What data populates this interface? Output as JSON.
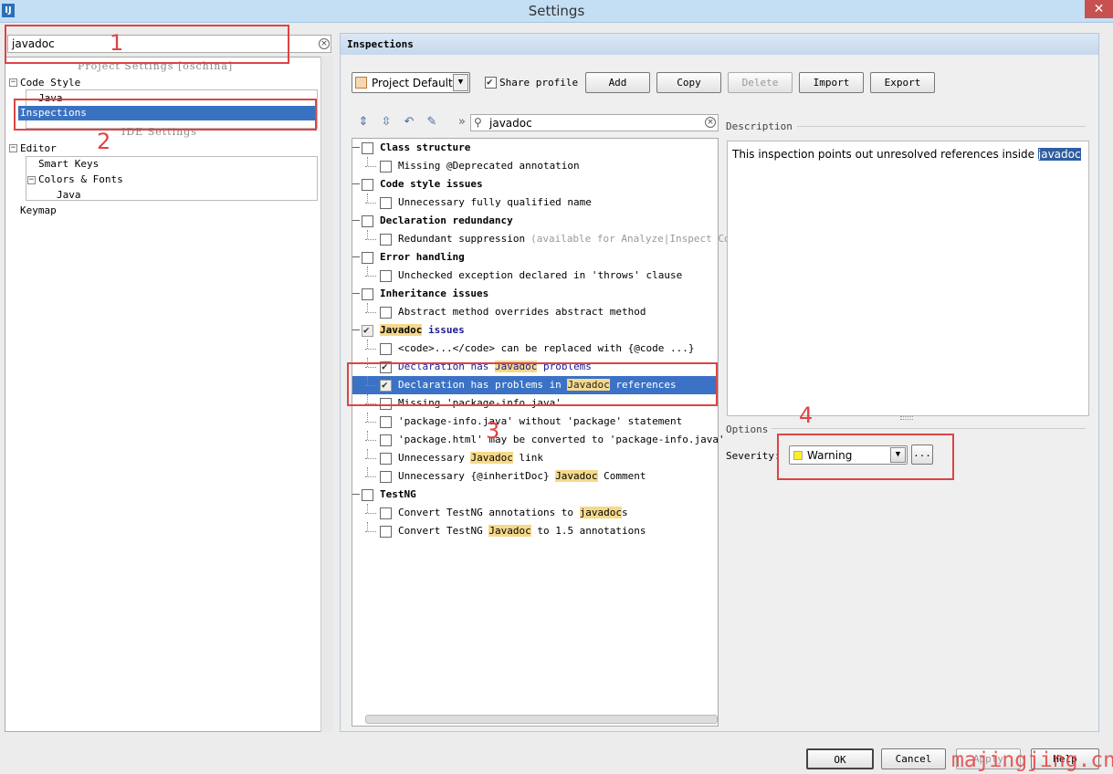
{
  "window": {
    "title": "Settings",
    "app_icon": "IJ"
  },
  "left": {
    "search_value": "javadoc",
    "project_settings_label": "Project Settings [oschina]",
    "ide_settings_label": "IDE Settings",
    "tree": {
      "code_style": "Code Style",
      "java": "Java",
      "inspections": "Inspections",
      "editor": "Editor",
      "smart_keys": "Smart Keys",
      "colors_fonts": "Colors & Fonts",
      "java2": "Java",
      "keymap": "Keymap"
    }
  },
  "panel": {
    "title": "Inspections",
    "profile": "Project Default",
    "share_profile": "Share profile",
    "buttons": {
      "add": "Add",
      "copy": "Copy",
      "delete": "Delete",
      "import": "Import",
      "export": "Export"
    },
    "filter_value": "javadoc",
    "description_label": "Description",
    "description_text": "This inspection points out unresolved references inside ",
    "description_selected": "javadoc",
    "options_label": "Options",
    "severity_label": "Severity:",
    "severity_value": "Warning",
    "severity_color": "#ffee22",
    "more_button": "..."
  },
  "inspections": [
    {
      "type": "cat",
      "label": "Class structure"
    },
    {
      "type": "sub",
      "label": "Missing @Deprecated annotation"
    },
    {
      "type": "cat",
      "label": "Code style issues"
    },
    {
      "type": "sub",
      "label": "Unnecessary fully qualified name"
    },
    {
      "type": "cat",
      "label": "Declaration redundancy"
    },
    {
      "type": "sub",
      "label": "Redundant suppression",
      "extra": "(available for Analyze|Inspect Code)"
    },
    {
      "type": "cat",
      "label": "Error handling"
    },
    {
      "type": "sub",
      "label": "Unchecked exception declared in 'throws' clause"
    },
    {
      "type": "cat",
      "label": "Inheritance issues"
    },
    {
      "type": "sub",
      "label": "Abstract method overrides abstract method"
    },
    {
      "type": "cat",
      "label_mark": "Javadoc",
      "label_rest": " issues"
    },
    {
      "type": "sub",
      "label": "<code>...</code> can be replaced with {@code ...}"
    },
    {
      "type": "sub",
      "pre": "Declaration has ",
      "mark": "Javadoc",
      "post": " problems"
    },
    {
      "type": "sub",
      "pre": "Declaration has problems in ",
      "mark": "Javadoc",
      "post": " references"
    },
    {
      "type": "sub",
      "label": "Missing 'package-info.java'"
    },
    {
      "type": "sub",
      "label": "'package-info.java' without 'package' statement"
    },
    {
      "type": "sub",
      "label": "'package.html' may be converted to 'package-info.java'"
    },
    {
      "type": "sub",
      "pre": "Unnecessary ",
      "mark": "Javadoc",
      "post": " link"
    },
    {
      "type": "sub",
      "pre": "Unnecessary {@inheritDoc} ",
      "mark": "Javadoc",
      "post": " Comment"
    },
    {
      "type": "cat",
      "label": "TestNG"
    },
    {
      "type": "sub",
      "pre": "Convert TestNG annotations to ",
      "mark": "javadoc",
      "post": "s"
    },
    {
      "type": "sub",
      "pre": "Convert TestNG ",
      "mark": "Javadoc",
      "post": " to 1.5 annotations"
    }
  ],
  "footer": {
    "ok": "OK",
    "cancel": "Cancel",
    "apply": "Apply",
    "help": "Help"
  },
  "annotations": [
    "1",
    "2",
    "3",
    "4"
  ],
  "watermark": "majingjing.cn"
}
